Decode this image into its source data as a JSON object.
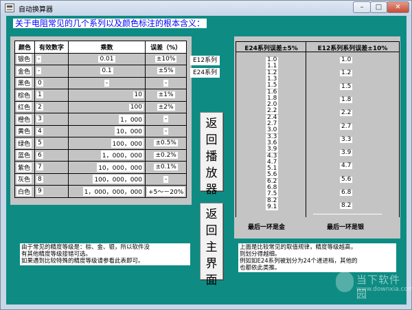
{
  "window": {
    "title": "自动换算器",
    "minimize": "–",
    "maximize": "□",
    "close": "✕"
  },
  "heading": "关于电阻常见的几个系列以及颜色标注的根本含义：",
  "table": {
    "headers": [
      "颜色",
      "有效数字",
      "乘数",
      "误差（%）"
    ],
    "rows": [
      [
        "银色",
        "-",
        "0.01",
        "±10%"
      ],
      [
        "金色",
        "-",
        "0.1",
        "±5%"
      ],
      [
        "黑色",
        "0",
        "-",
        "-"
      ],
      [
        "棕色",
        "1",
        "10",
        "±1%"
      ],
      [
        "红色",
        "2",
        "100",
        "±2%"
      ],
      [
        "橙色",
        "3",
        "1，000",
        "-"
      ],
      [
        "黄色",
        "4",
        "10，000",
        "-"
      ],
      [
        "绿色",
        "5",
        "100，000",
        "±0.5%"
      ],
      [
        "蓝色",
        "6",
        "1，000，000",
        "±0.2%"
      ],
      [
        "紫色",
        "7",
        "10，000，000",
        "±0.1%"
      ],
      [
        "灰色",
        "8",
        "100，000，000",
        "-"
      ],
      [
        "白色",
        "9",
        "1，000，000，000",
        "+5～－20%"
      ]
    ]
  },
  "labels": {
    "e12": "E12系列",
    "e24": "E24系列"
  },
  "buttons": {
    "back_player": [
      "返",
      "回",
      "播",
      "放",
      "器"
    ],
    "back_main": [
      "返",
      "回",
      "主",
      "界",
      "面"
    ]
  },
  "series": {
    "e24_header": "E24系列误差±5%",
    "e12_header": "E12系列系列误差±10%",
    "e24": [
      "1.0",
      "1.1",
      "1.2",
      "1.3",
      "1.5",
      "1.6",
      "1.8",
      "2.0",
      "2.2",
      "2.4",
      "2.7",
      "3.0",
      "3.3",
      "3.6",
      "3.9",
      "4.3",
      "4.7",
      "5.1",
      "5.6",
      "6.2",
      "6.8",
      "7.5",
      "8.2",
      "9.1"
    ],
    "e12": [
      "1.0",
      "1.2",
      "1.5",
      "1.8",
      "2.2",
      "2.7",
      "3.3",
      "3.9",
      "4.7",
      "5.6",
      "6.8",
      "8.2"
    ],
    "e24_footer": "最后一环是金",
    "e12_footer": "最后一环是银"
  },
  "notes": {
    "left": [
      "由于常见的精度等级是：棕、金、银，所以软件没",
      "有其他精度等级接错可选。",
      "如果遇到比较特殊的精度等级请参看此表即可。"
    ],
    "right": [
      "上面是比较常见的取值规律，精度等级越高，",
      "则划分得越细。",
      "例如如E24系列被划分为24个递进档，其他的",
      "也都依此类推。"
    ]
  },
  "watermark": {
    "brand": "当下软件园",
    "url": "www.downxia.com"
  }
}
